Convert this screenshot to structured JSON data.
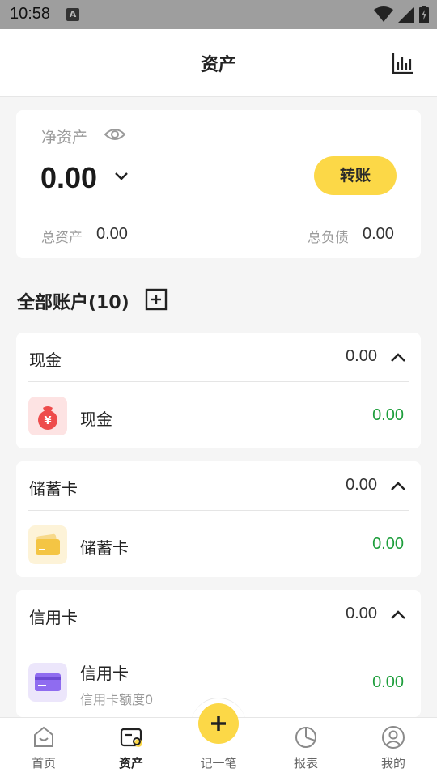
{
  "status_bar": {
    "time": "10:58",
    "notification": "A"
  },
  "header": {
    "title": "资产",
    "chart_icon": "bar-chart-icon"
  },
  "net_assets": {
    "label": "净资产",
    "value": "0.00",
    "transfer_label": "转账",
    "total_assets_label": "总资产",
    "total_assets_value": "0.00",
    "total_debt_label": "总负债",
    "total_debt_value": "0.00"
  },
  "accounts_section": {
    "title": "全部账户(10)"
  },
  "groups": [
    {
      "name": "现金",
      "total": "0.00",
      "accounts": [
        {
          "name": "现金",
          "value": "0.00",
          "icon": "money-bag-icon"
        }
      ]
    },
    {
      "name": "储蓄卡",
      "total": "0.00",
      "accounts": [
        {
          "name": "储蓄卡",
          "value": "0.00",
          "icon": "debit-card-icon"
        }
      ]
    },
    {
      "name": "信用卡",
      "total": "0.00",
      "accounts": [
        {
          "name": "信用卡",
          "sub": "信用卡额度0",
          "value": "0.00",
          "icon": "credit-card-icon"
        }
      ]
    }
  ],
  "bottom_nav": [
    {
      "label": "首页",
      "icon": "home-icon"
    },
    {
      "label": "资产",
      "icon": "wallet-icon",
      "active": true
    },
    {
      "label": "记一笔",
      "icon": "plus-icon"
    },
    {
      "label": "报表",
      "icon": "pie-chart-icon"
    },
    {
      "label": "我的",
      "icon": "user-icon"
    }
  ],
  "colors": {
    "accent": "#fcd847",
    "positive": "#1e9e3c",
    "muted": "#9a9a9a"
  }
}
